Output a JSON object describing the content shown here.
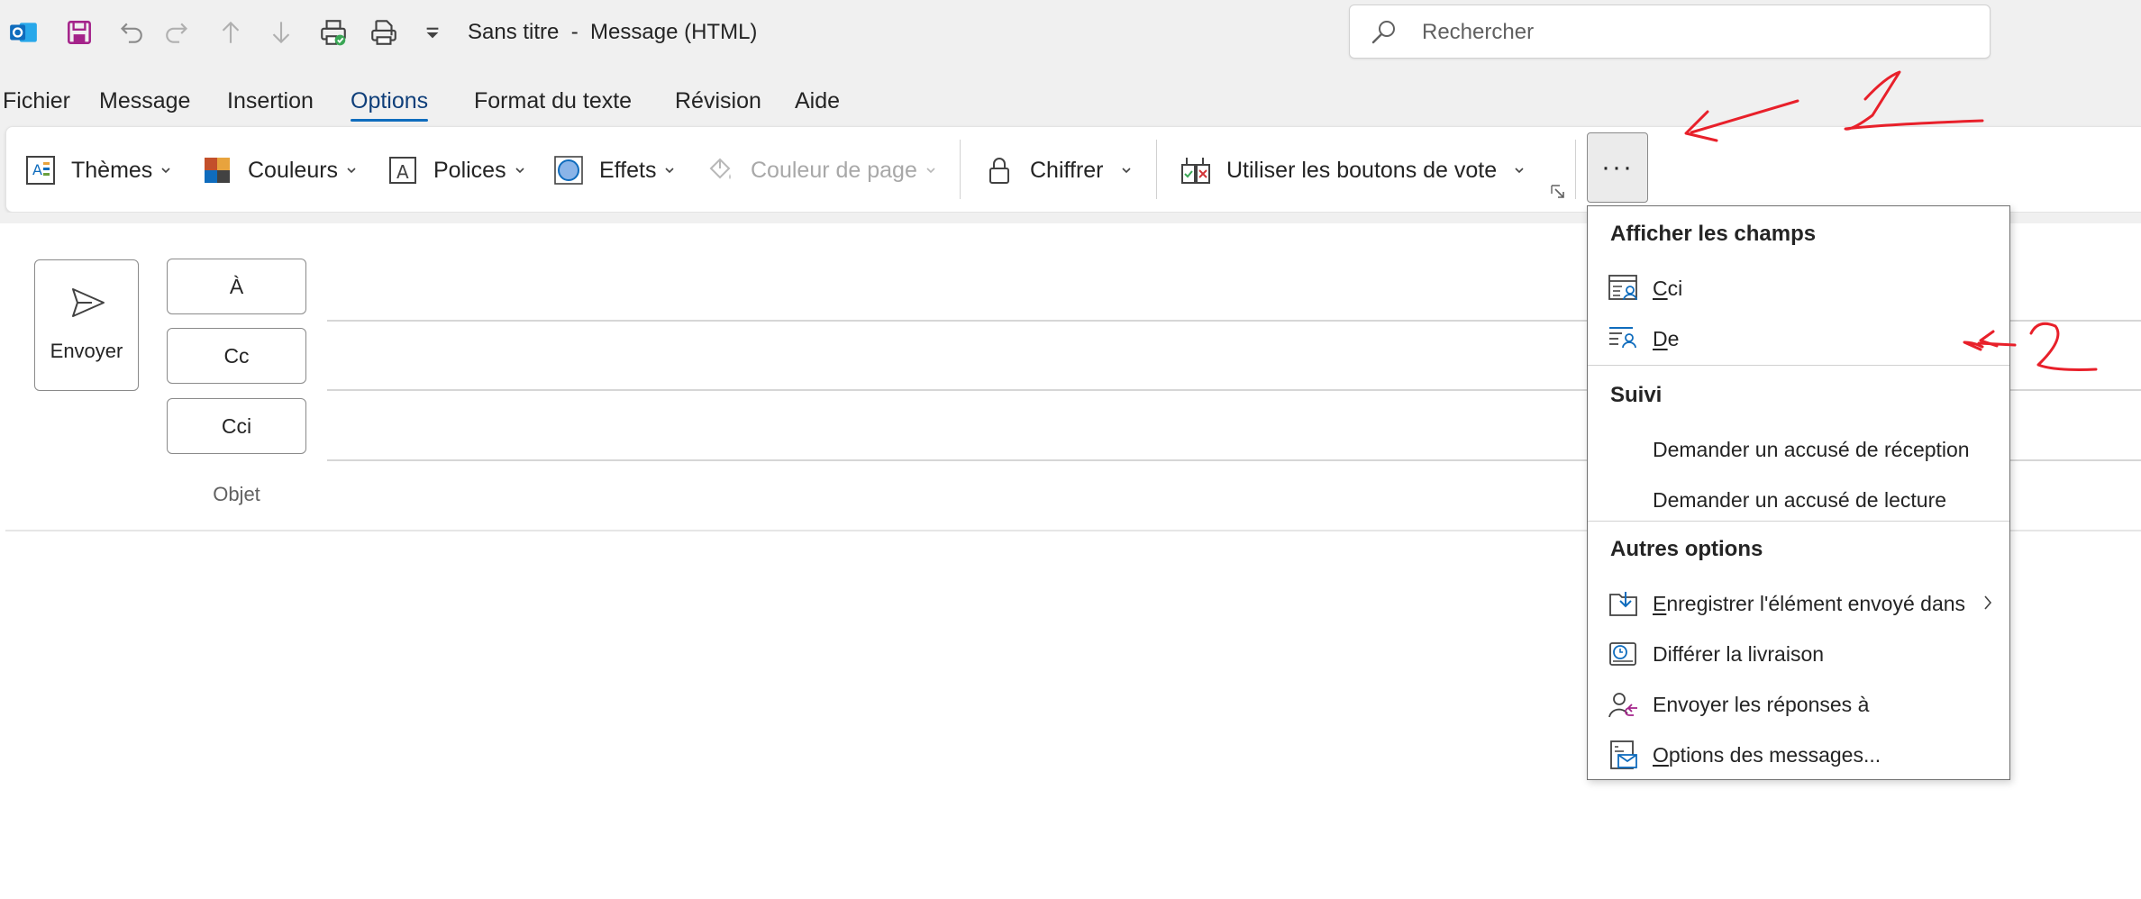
{
  "window": {
    "title": "Sans titre  -  Message (HTML)"
  },
  "quick_access": [
    "outlook-app-icon",
    "save-icon",
    "undo-icon",
    "redo-icon",
    "previous-item-icon",
    "next-item-icon",
    "print-preview-icon",
    "print-icon",
    "customize-toolbar-icon"
  ],
  "search": {
    "placeholder": "Rechercher"
  },
  "tabs": [
    {
      "label": "Fichier"
    },
    {
      "label": "Message"
    },
    {
      "label": "Insertion"
    },
    {
      "label": "Options",
      "active": true
    },
    {
      "label": "Format du texte"
    },
    {
      "label": "Révision"
    },
    {
      "label": "Aide"
    }
  ],
  "ribbon": {
    "themes": "Thèmes",
    "colors": "Couleurs",
    "fonts": "Polices",
    "effects": "Effets",
    "page_color": "Couleur de page",
    "encrypt": "Chiffrer",
    "voting": "Utiliser les boutons de vote",
    "more": "···"
  },
  "compose": {
    "send": "Envoyer",
    "to": "À",
    "cc": "Cc",
    "bcc": "Cci",
    "subject_label": "Objet"
  },
  "dropdown": {
    "section_show_fields": "Afficher les champs",
    "bcc_prefix": "C",
    "bcc_rest": "ci",
    "from_prefix": "D",
    "from_rest": "e",
    "section_tracking": "Suivi",
    "delivery_receipt": "Demander un accusé de réception",
    "read_receipt": "Demander un accusé de lecture",
    "section_more_options": "Autres options",
    "save_sent_prefix": "E",
    "save_sent_rest": "nregistrer l'élément envoyé dans",
    "delay_delivery": "Différer la livraison",
    "direct_replies": "Envoyer les réponses à",
    "message_options_prefix": "O",
    "message_options_rest": "ptions des messages..."
  },
  "annotations": {
    "label_1": "1",
    "label_2": "2",
    "ink_color": "#e8202a"
  },
  "colors": {
    "accent": "#0f6cbd",
    "chrome": "#f0f0f0",
    "save_purple": "#a4238a",
    "outlook_blue": "#0f6cbd"
  }
}
